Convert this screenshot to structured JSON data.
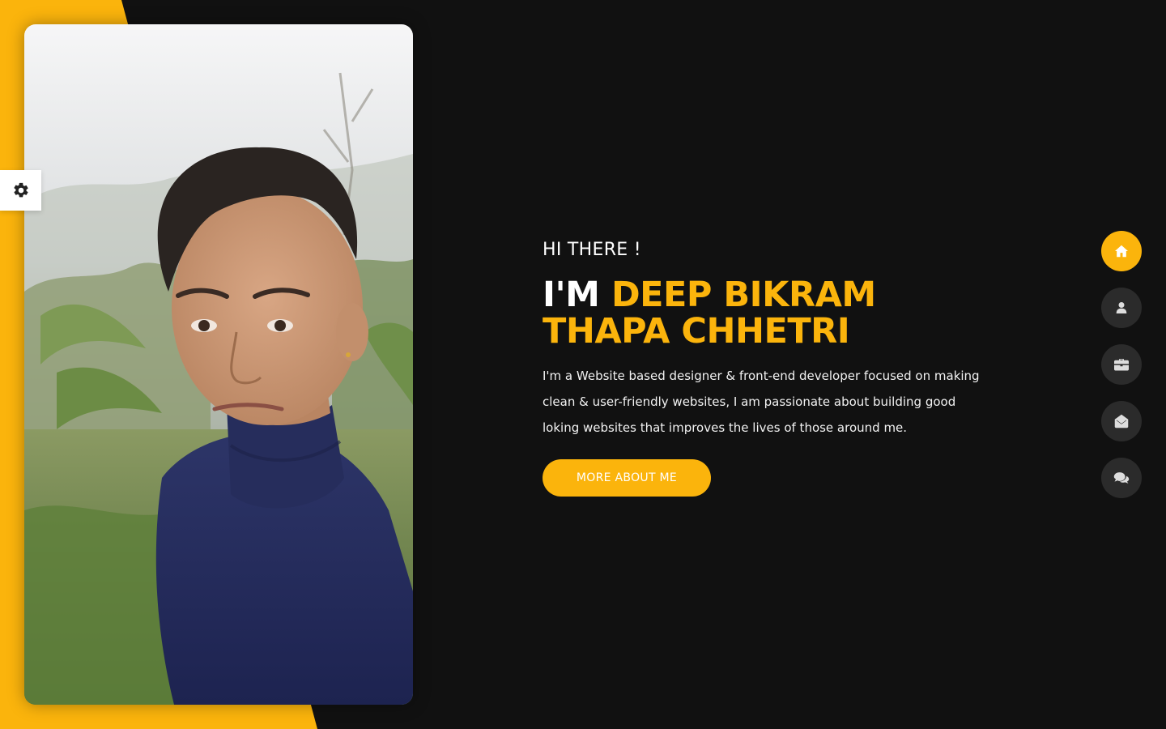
{
  "theme": {
    "accent": "#fbb40c",
    "background": "#111111",
    "nav_inactive": "#2b2b2b"
  },
  "settings": {
    "icon": "gear-icon"
  },
  "photo": {
    "alt": "portrait photo"
  },
  "hero": {
    "greeting": "HI THERE !",
    "name_prefix": "I'M",
    "name": "DEEP BIKRAM THAPA CHHETRI",
    "intro": "I'm a Website based designer & front-end developer focused on making clean & user-friendly websites, I am passionate about building good loking websites that improves the lives of those around me.",
    "cta_label": "MORE ABOUT ME"
  },
  "nav": {
    "items": [
      {
        "icon": "home-icon",
        "active": true
      },
      {
        "icon": "user-icon",
        "active": false
      },
      {
        "icon": "briefcase-icon",
        "active": false
      },
      {
        "icon": "envelope-open-icon",
        "active": false
      },
      {
        "icon": "comments-icon",
        "active": false
      }
    ]
  }
}
